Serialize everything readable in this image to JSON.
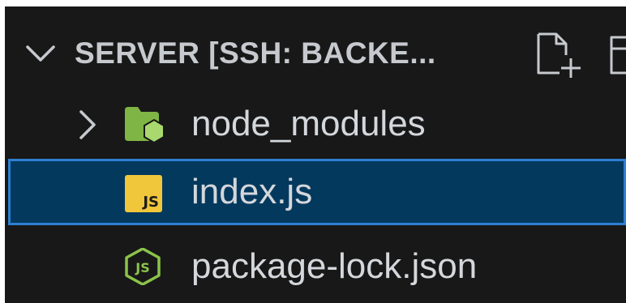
{
  "explorer": {
    "section_title": "SERVER [SSH: BACKE...",
    "header_actions": [
      {
        "name": "new-file",
        "icon": "new-file-icon"
      },
      {
        "name": "new-folder",
        "icon": "new-folder-icon"
      }
    ],
    "items": [
      {
        "label": "node_modules",
        "type": "folder",
        "expanded": false,
        "icon": "folder-icon",
        "icon_color": "#8bc34a"
      },
      {
        "label": "index.js",
        "type": "file",
        "selected": true,
        "icon": "javascript-file-icon",
        "icon_text": "JS",
        "icon_color": "#f0c63a"
      },
      {
        "label": "package-lock.json",
        "type": "file",
        "icon": "nodejs-icon",
        "icon_color": "#8bc34a"
      }
    ]
  },
  "colors": {
    "background": "#181818",
    "selection_background": "#04395e",
    "selection_border": "#2d7fd3",
    "text": "#d4d7db"
  }
}
